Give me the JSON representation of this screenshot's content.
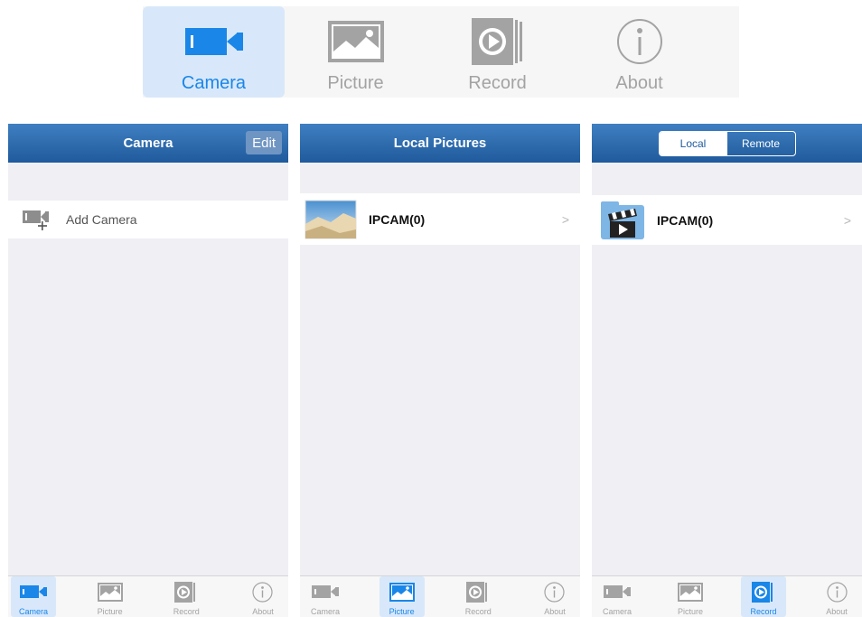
{
  "colors": {
    "active": "#1a86e8",
    "inactive": "#a3a3a3",
    "nav": "#2b6aae"
  },
  "big_tabs": [
    {
      "label": "Camera",
      "icon": "video-camera-icon"
    },
    {
      "label": "Picture",
      "icon": "picture-icon"
    },
    {
      "label": "Record",
      "icon": "record-play-icon"
    },
    {
      "label": "About",
      "icon": "info-icon"
    }
  ],
  "screen_camera": {
    "title": "Camera",
    "edit_label": "Edit",
    "row_label": "Add Camera"
  },
  "screen_pictures": {
    "title": "Local Pictures",
    "row_label": "IPCAM(0)"
  },
  "screen_record": {
    "segment_local": "Local",
    "segment_remote": "Remote",
    "row_label": "IPCAM(0)"
  },
  "small_tabs": {
    "camera": "Camera",
    "picture": "Picture",
    "record": "Record",
    "about": "About"
  }
}
